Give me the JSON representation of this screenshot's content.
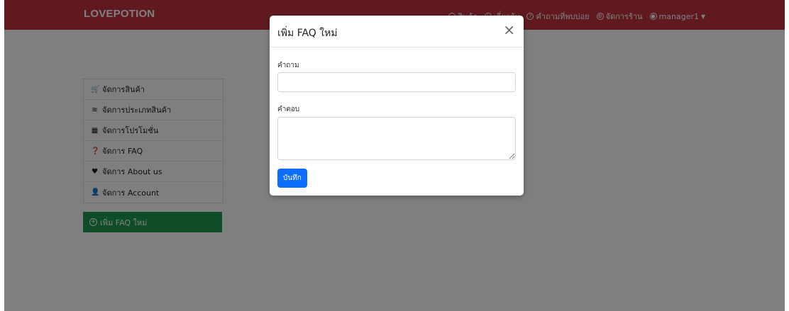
{
  "navbar": {
    "brand": "LOVEPOTION",
    "links": [
      {
        "label": "สินค้า",
        "icon": "store-icon"
      },
      {
        "label": "เกี่ยวกับ",
        "icon": "info-icon"
      },
      {
        "label": "คำถามที่พบบ่อย",
        "icon": "question-icon"
      },
      {
        "label": "จัดการร้าน",
        "icon": "gear-icon"
      },
      {
        "label": "manager1",
        "icon": "user-icon"
      }
    ]
  },
  "sidebar": {
    "items": [
      {
        "label": "จัดการสินค้า",
        "icon": "cart-icon"
      },
      {
        "label": "จัดการประเภทสินค้า",
        "icon": "layers-icon"
      },
      {
        "label": "จัดการโปรโมชั่น",
        "icon": "gift-icon"
      },
      {
        "label": "จัดการ FAQ",
        "icon": "question-circle-icon"
      },
      {
        "label": "จัดการ About us",
        "icon": "heart-icon"
      },
      {
        "label": "จัดการ Account",
        "icon": "user-icon"
      }
    ],
    "add_button": "เพิ่ม FAQ ใหม่"
  },
  "modal": {
    "title": "เพิ่ม FAQ ใหม่",
    "close": "×",
    "question_label": "คำถาม",
    "question_value": "",
    "answer_label": "คำตอบ",
    "answer_value": "",
    "save_label": "บันทึก"
  },
  "colors": {
    "navbar": "#c0343f",
    "add_button": "#1c9a4f",
    "save_button": "#0d6efd"
  }
}
